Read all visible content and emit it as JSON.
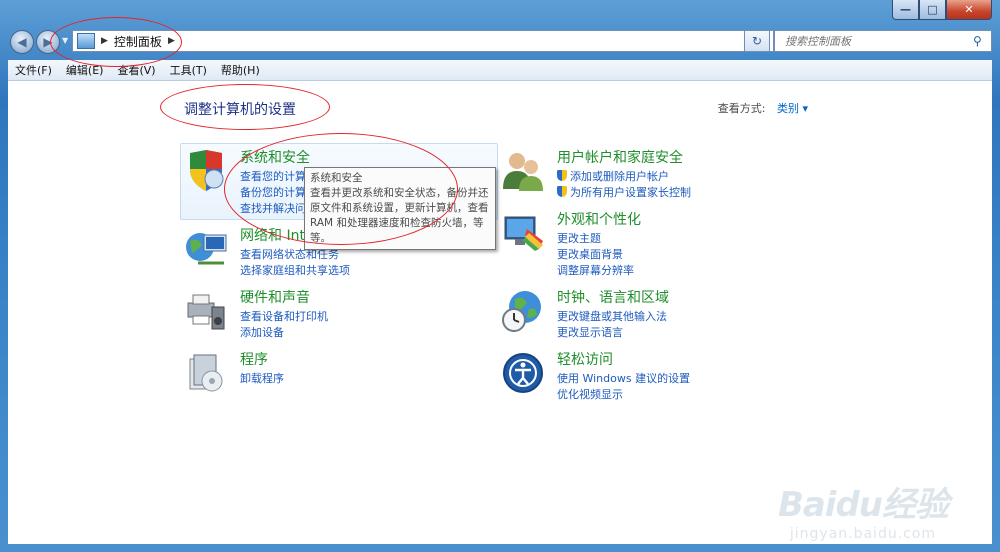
{
  "window": {
    "min_glyph": "—",
    "max_glyph": "□",
    "close_glyph": "✕"
  },
  "nav": {
    "back_icon": "back-arrow-icon",
    "forward_icon": "forward-arrow-icon",
    "address": "控制面板",
    "search_placeholder": "搜索控制面板"
  },
  "menu": [
    "文件(F)",
    "编辑(E)",
    "查看(V)",
    "工具(T)",
    "帮助(H)"
  ],
  "header": {
    "title": "调整计算机的设置",
    "viewby_label": "查看方式:",
    "viewby_value": "类别"
  },
  "categories": {
    "system": {
      "title": "系统和安全",
      "links": [
        "查看您的计算机状态",
        "备份您的计算机",
        "查找并解决问题"
      ]
    },
    "network": {
      "title": "网络和 Internet",
      "links": [
        "查看网络状态和任务",
        "选择家庭组和共享选项"
      ]
    },
    "hardware": {
      "title": "硬件和声音",
      "links": [
        "查看设备和打印机",
        "添加设备"
      ]
    },
    "programs": {
      "title": "程序",
      "links": [
        "卸载程序"
      ]
    },
    "users": {
      "title": "用户帐户和家庭安全",
      "links": [
        "添加或删除用户帐户",
        "为所有用户设置家长控制"
      ]
    },
    "appearance": {
      "title": "外观和个性化",
      "links": [
        "更改主题",
        "更改桌面背景",
        "调整屏幕分辨率"
      ]
    },
    "clock": {
      "title": "时钟、语言和区域",
      "links": [
        "更改键盘或其他输入法",
        "更改显示语言"
      ]
    },
    "ease": {
      "title": "轻松访问",
      "links": [
        "使用 Windows 建议的设置",
        "优化视频显示"
      ]
    }
  },
  "tooltip": {
    "title": "系统和安全",
    "body": "查看并更改系统和安全状态，备份并还原文件和系统设置，更新计算机，查看 RAM 和处理器速度和检查防火墙，等等。"
  },
  "watermark": {
    "logo": "Baidu经验",
    "sub": "jingyan.baidu.com"
  }
}
